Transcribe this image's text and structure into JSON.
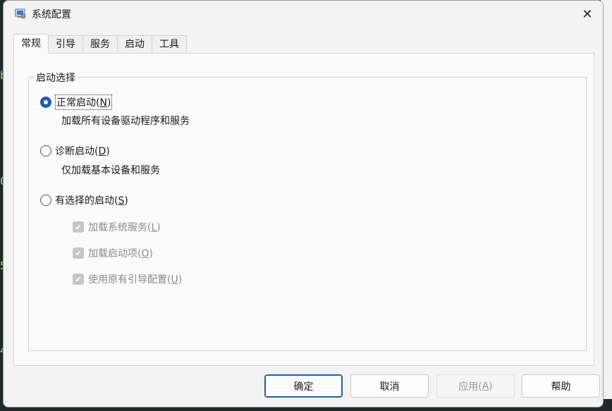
{
  "window": {
    "title": "系统配置",
    "close_glyph": "✕"
  },
  "tabs": [
    {
      "label": "常规",
      "active": true
    },
    {
      "label": "引导",
      "active": false
    },
    {
      "label": "服务",
      "active": false
    },
    {
      "label": "启动",
      "active": false
    },
    {
      "label": "工具",
      "active": false
    }
  ],
  "startup_group": {
    "legend": "启动选择",
    "normal": {
      "label_prefix": "正常启动(",
      "accel": "N",
      "label_suffix": ")",
      "description": "加载所有设备驱动程序和服务",
      "checked": true
    },
    "diagnostic": {
      "label_prefix": "诊断启动(",
      "accel": "D",
      "label_suffix": ")",
      "description": "仅加载基本设备和服务",
      "checked": false
    },
    "selective": {
      "label_prefix": "有选择的启动(",
      "accel": "S",
      "label_suffix": ")",
      "checked": false,
      "options": [
        {
          "prefix": "加载系统服务(",
          "accel": "L",
          "suffix": ")",
          "checked": true,
          "enabled": false
        },
        {
          "prefix": "加载启动项(",
          "accel": "O",
          "suffix": ")",
          "checked": true,
          "enabled": false
        },
        {
          "prefix": "使用原有引导配置(",
          "accel": "U",
          "suffix": ")",
          "checked": true,
          "enabled": false
        }
      ]
    }
  },
  "buttons": {
    "ok": "确定",
    "cancel": "取消",
    "apply_prefix": "应用(",
    "apply_accel": "A",
    "apply_suffix": ")",
    "help": "帮助"
  },
  "colors": {
    "accent": "#1a5fb4",
    "window_bg": "#f3f3f3",
    "panel_bg": "#fbfbfb",
    "disabled_text": "#8a8a8a"
  }
}
